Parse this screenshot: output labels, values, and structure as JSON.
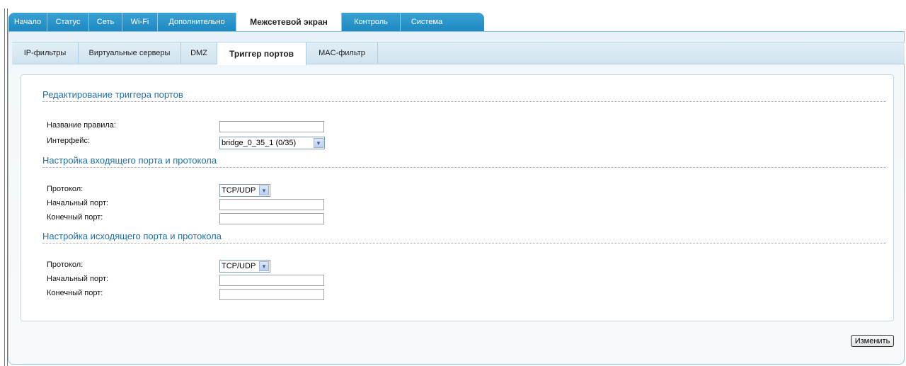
{
  "top_nav": {
    "tabs": [
      {
        "label": "Начало",
        "active": false
      },
      {
        "label": "Статус",
        "active": false
      },
      {
        "label": "Сеть",
        "active": false
      },
      {
        "label": "Wi-Fi",
        "active": false
      },
      {
        "label": "Дополнительно",
        "active": false
      },
      {
        "label": "Межсетевой экран",
        "active": true
      },
      {
        "label": "Контроль",
        "active": false
      },
      {
        "label": "Система",
        "active": false
      }
    ]
  },
  "sub_nav": {
    "tabs": [
      {
        "label": "IP-фильтры",
        "active": false
      },
      {
        "label": "Виртуальные серверы",
        "active": false
      },
      {
        "label": "DMZ",
        "active": false
      },
      {
        "label": "Триггер портов",
        "active": true
      },
      {
        "label": "MAC-фильтр",
        "active": false
      }
    ]
  },
  "form": {
    "edit_section": {
      "title": "Редактирование триггера портов",
      "rule_name_label": "Название правила:",
      "rule_name_value": "",
      "interface_label": "Интерфейс:",
      "interface_value": "bridge_0_35_1 (0/35)"
    },
    "incoming_section": {
      "title": "Настройка входящего порта и протокола",
      "protocol_label": "Протокол:",
      "protocol_value": "TCP/UDP",
      "start_port_label": "Начальный порт:",
      "start_port_value": "",
      "end_port_label": "Конечный порт:",
      "end_port_value": ""
    },
    "outgoing_section": {
      "title": "Настройка исходящего порта и протокола",
      "protocol_label": "Протокол:",
      "protocol_value": "TCP/UDP",
      "start_port_label": "Начальный порт:",
      "start_port_value": "",
      "end_port_label": "Конечный порт:",
      "end_port_value": ""
    }
  },
  "actions": {
    "change_label": "Изменить"
  },
  "colors": {
    "tab_bar": "#1d88c2",
    "section_title": "#1f6fa8"
  },
  "icons": {
    "select_arrow": "chevron-down-icon"
  }
}
